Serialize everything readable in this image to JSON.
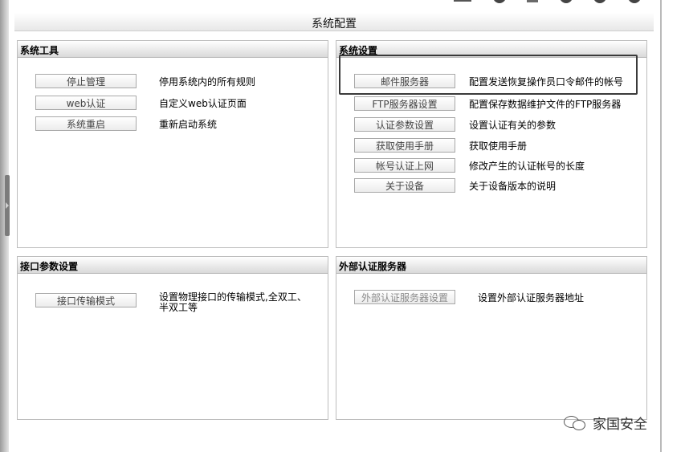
{
  "page_title": "系统配置",
  "panels": {
    "system_tools": {
      "title": "系统工具",
      "items": [
        {
          "button": "停止管理",
          "desc": "停用系统内的所有规则"
        },
        {
          "button": "web认证",
          "desc": "自定义web认证页面"
        },
        {
          "button": "系统重启",
          "desc": "重新启动系统"
        }
      ]
    },
    "system_settings": {
      "title": "系统设置",
      "items": [
        {
          "button": "邮件服务器",
          "desc": "配置发送恢复操作员口令邮件的帐号"
        },
        {
          "button": "FTP服务器设置",
          "desc": "配置保存数据维护文件的FTP服务器"
        },
        {
          "button": "认证参数设置",
          "desc": "设置认证有关的参数"
        },
        {
          "button": "获取使用手册",
          "desc": "获取使用手册"
        },
        {
          "button": "帐号认证上网",
          "desc": "修改产生的认证帐号的长度"
        },
        {
          "button": "关于设备",
          "desc": "关于设备版本的说明"
        }
      ]
    },
    "interface_params": {
      "title": "接口参数设置",
      "items": [
        {
          "button": "接口传输模式",
          "desc": "设置物理接口的传输模式,全双工、半双工等"
        }
      ]
    },
    "external_auth": {
      "title": "外部认证服务器",
      "items": [
        {
          "button": "外部认证服务器设置",
          "desc": "设置外部认证服务器地址"
        }
      ]
    }
  },
  "watermark": {
    "text": "家国安全",
    "icon": "wechat-icon"
  },
  "colors": {
    "panel_border": "#bdbdbd",
    "highlight_border": "#3a3a3a",
    "button_text": "#444444"
  }
}
